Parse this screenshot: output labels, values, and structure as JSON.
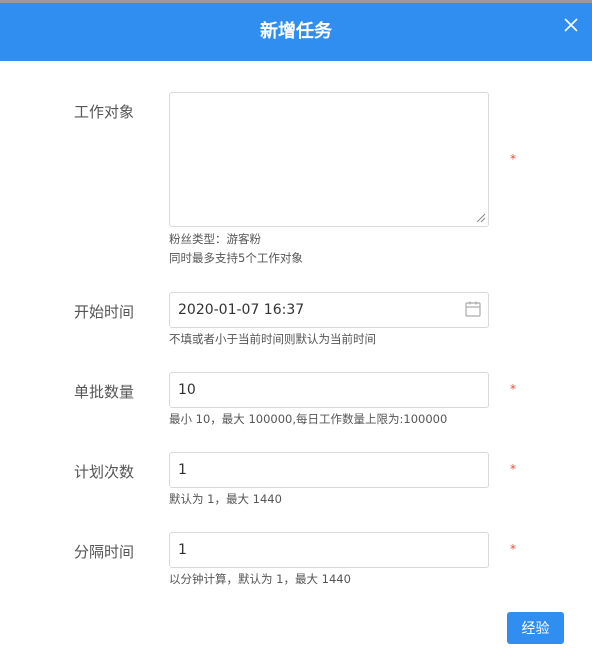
{
  "dialog": {
    "title": "新增任务",
    "close_icon": "close-icon"
  },
  "form": {
    "target": {
      "label": "工作对象",
      "value": "",
      "hint1": "粉丝类型：游客粉",
      "hint2": "同时最多支持5个工作对象",
      "required": "*"
    },
    "start_time": {
      "label": "开始时间",
      "value": "2020-01-07 16:37",
      "hint": "不填或者小于当前时间则默认为当前时间",
      "icon": "calendar-icon"
    },
    "batch_count": {
      "label": "单批数量",
      "value": "10",
      "hint": "最小 10，最大 100000,每日工作数量上限为:100000",
      "required": "*"
    },
    "plan_times": {
      "label": "计划次数",
      "value": "1",
      "hint": "默认为 1，最大 1440",
      "required": "*"
    },
    "interval": {
      "label": "分隔时间",
      "value": "1",
      "hint": "以分钟计算，默认为 1，最大 1440",
      "required": "*"
    }
  },
  "footer": {
    "submit_label": "经验"
  },
  "colors": {
    "header": "#2f8ef0",
    "required": "#e84c3d"
  }
}
